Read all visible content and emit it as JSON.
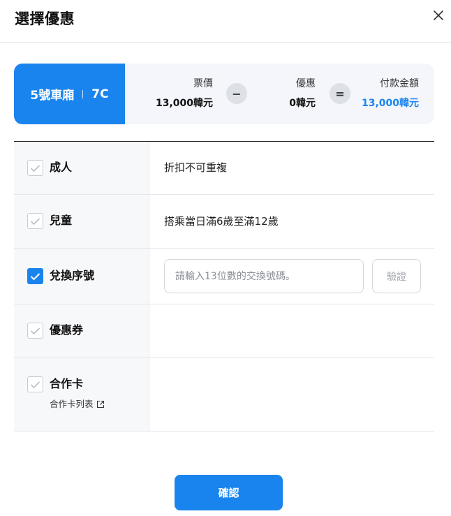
{
  "modal": {
    "title": "選擇優惠",
    "close_icon": "close-icon"
  },
  "seat": {
    "car": "5號車廂",
    "seat": "7C"
  },
  "summary": {
    "fare_label": "票價",
    "fare_value": "13,000韓元",
    "minus_symbol": "−",
    "discount_label": "優惠",
    "discount_value": "0韓元",
    "equals_symbol": "=",
    "total_label": "付款金額",
    "total_value": "13,000韓元"
  },
  "options": [
    {
      "label": "成人",
      "description": "折扣不可重複",
      "checked": false
    },
    {
      "label": "兒童",
      "description": "搭乘當日滿6歲至滿12歲",
      "checked": false
    },
    {
      "label": "兌換序號",
      "description": "",
      "checked": true
    },
    {
      "label": "優惠券",
      "description": "",
      "checked": false
    },
    {
      "label": "合作卡",
      "description": "",
      "checked": false
    }
  ],
  "serial": {
    "placeholder": "請輸入13位數的交換號碼。",
    "value": "",
    "verify_label": "驗證"
  },
  "card_list_link": "合作卡列表",
  "confirm_label": "確認",
  "colors": {
    "primary": "#1a84ee",
    "card_bg": "#f4f6fb",
    "left_col_bg": "#f7f8fa",
    "border": "#e4e6ea"
  }
}
